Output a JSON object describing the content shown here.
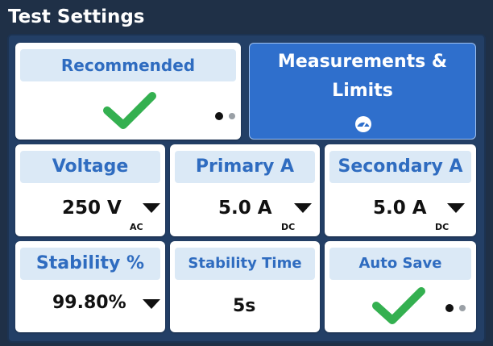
{
  "panel": {
    "title": "Test Settings"
  },
  "tiles": {
    "recommended": {
      "label": "Recommended"
    },
    "measurements": {
      "label_line1": "Measurements &",
      "label_line2": "Limits"
    },
    "voltage": {
      "label": "Voltage",
      "value": "250 V",
      "unit": "AC"
    },
    "primary_a": {
      "label": "Primary A",
      "value": "5.0 A",
      "unit": "DC"
    },
    "secondary_a": {
      "label": "Secondary A",
      "value": "5.0 A",
      "unit": "DC"
    },
    "stability": {
      "label": "Stability %",
      "value": "99.80%"
    },
    "stability_time": {
      "label": "Stability Time",
      "value": "5s"
    },
    "auto_save": {
      "label": "Auto Save"
    }
  },
  "colors": {
    "accent": "#2f6fcc",
    "check": "#34b050",
    "header_bg": "#dbe9f6",
    "header_text": "#2f6cc0"
  },
  "icons": [
    "check-icon",
    "dropdown-arrow-icon",
    "gauge-icon",
    "page-dot-icon"
  ]
}
